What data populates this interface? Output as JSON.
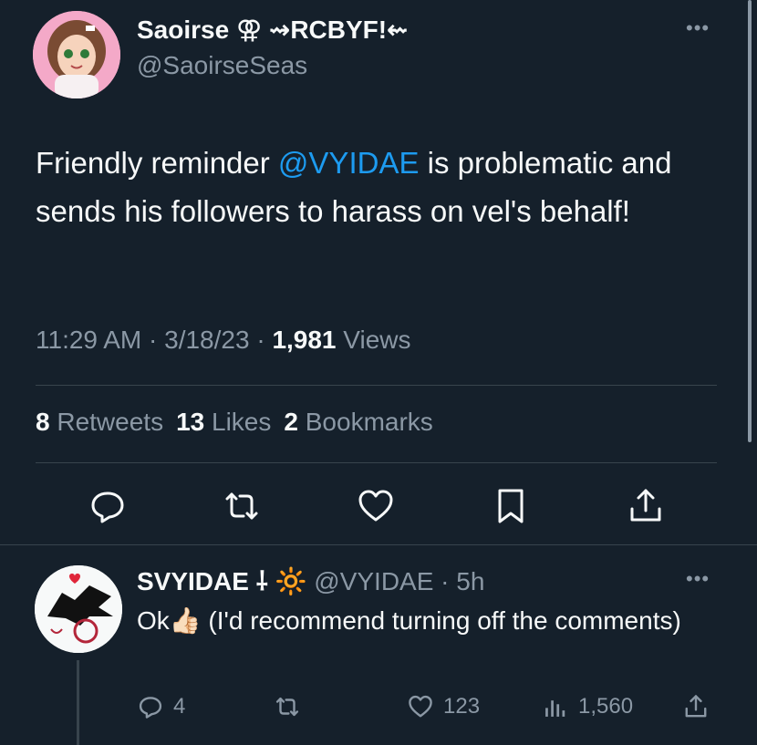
{
  "tweet": {
    "display_name": "Saoirse ⚢ ⇝RCBYF!⇜",
    "handle": "@SaoirseSeas",
    "text_before": "Friendly reminder ",
    "mention": "@VYIDAE",
    "text_after": " is problematic and sends his followers to harass on vel's behalf!",
    "time": "11:29 AM",
    "date": "3/18/23",
    "views_count": "1,981",
    "views_label": "Views",
    "retweets_count": "8",
    "retweets_label": "Retweets",
    "likes_count": "13",
    "likes_label": "Likes",
    "bookmarks_count": "2",
    "bookmarks_label": "Bookmarks",
    "more": "•••"
  },
  "reply": {
    "display_name": "SVYIDAE ⸸ 🔆",
    "handle": "@VYIDAE",
    "age": "5h",
    "text": "Ok👍🏻 (I'd recommend turning off the comments)",
    "reply_count": "4",
    "like_count": "123",
    "view_count": "1,560",
    "more": "•••"
  },
  "colors": {
    "background": "#15202b",
    "text": "#f7f9f9",
    "secondary": "#8b98a5",
    "accent": "#1d9bf0",
    "divider": "#38444d"
  },
  "icons": {
    "tweet_actions": [
      "reply-icon",
      "retweet-icon",
      "like-icon",
      "bookmark-icon",
      "share-icon"
    ],
    "reply_actions": [
      "reply-icon",
      "retweet-icon",
      "like-icon",
      "views-icon",
      "share-icon"
    ]
  }
}
